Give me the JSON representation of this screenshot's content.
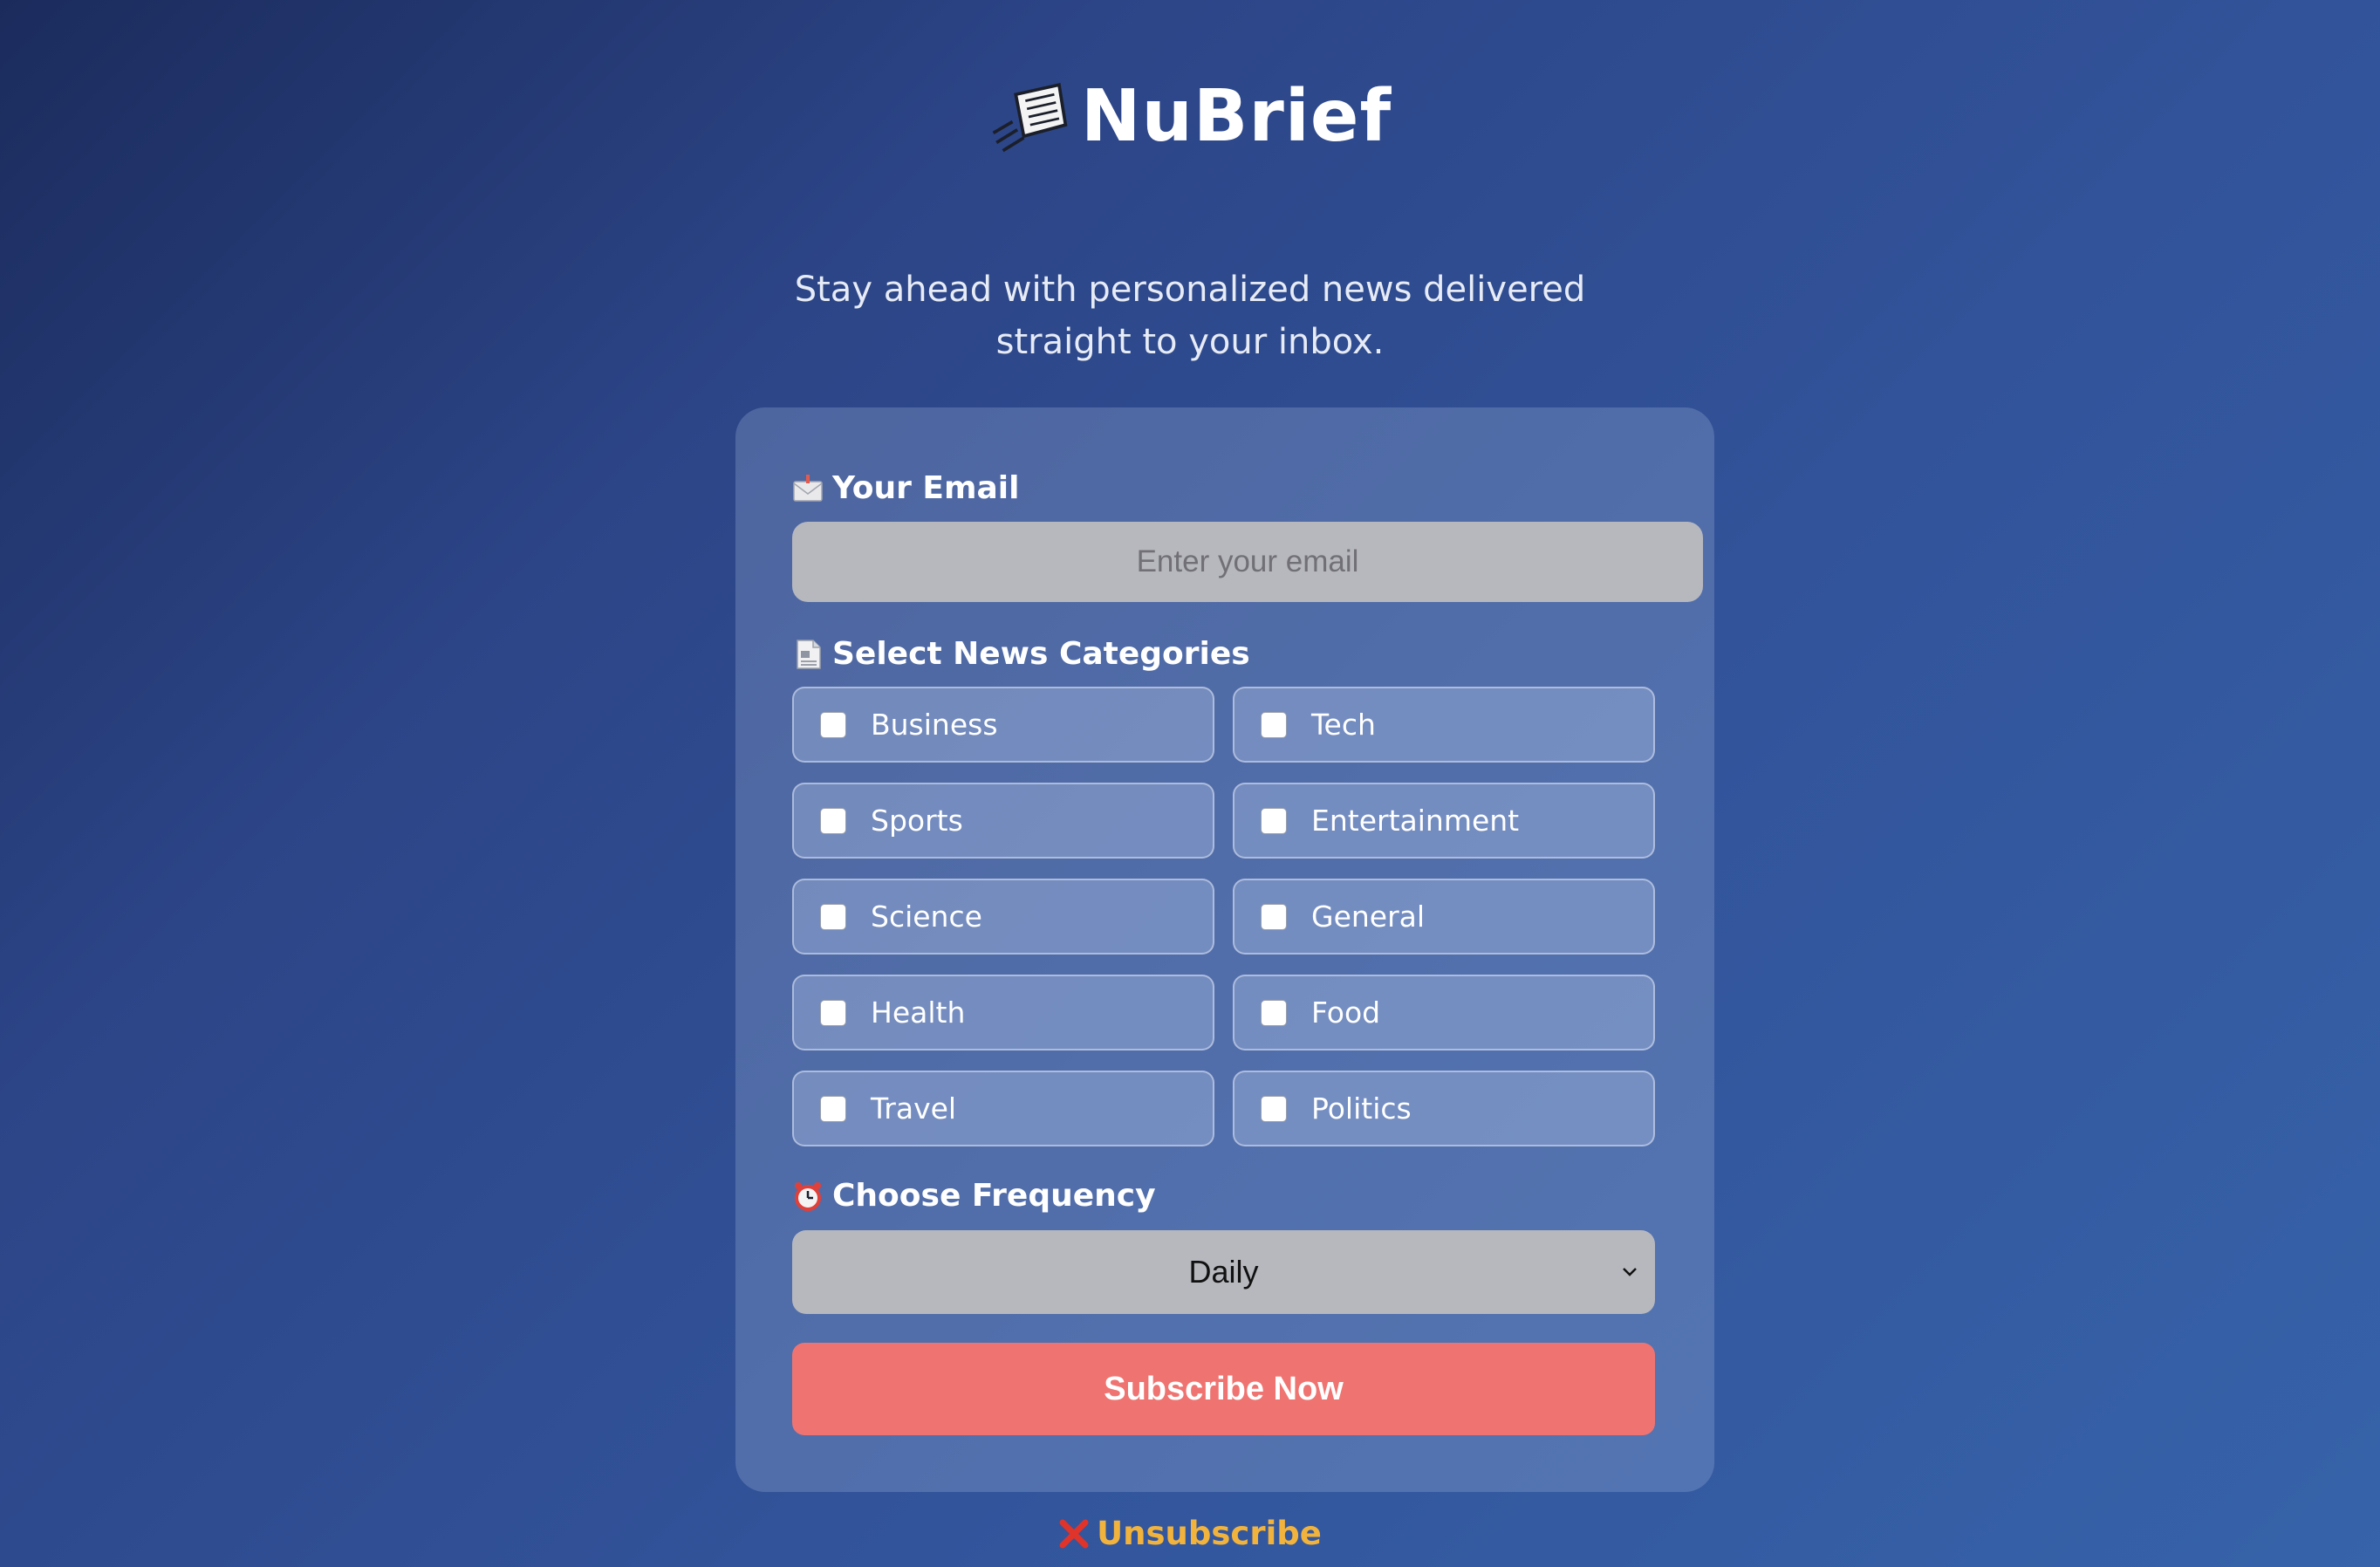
{
  "brand": {
    "name": "NuBrief",
    "icon": "flying-newspaper-icon"
  },
  "tagline": {
    "line1": "Stay ahead with personalized news delivered",
    "line2": "straight to your inbox."
  },
  "form": {
    "email": {
      "label": "Your Email",
      "icon": "envelope-icon",
      "placeholder": "Enter your email",
      "value": ""
    },
    "categories": {
      "label": "Select News Categories",
      "icon": "document-icon",
      "items": [
        {
          "label": "Business",
          "checked": false
        },
        {
          "label": "Tech",
          "checked": false
        },
        {
          "label": "Sports",
          "checked": false
        },
        {
          "label": "Entertainment",
          "checked": false
        },
        {
          "label": "Science",
          "checked": false
        },
        {
          "label": "General",
          "checked": false
        },
        {
          "label": "Health",
          "checked": false
        },
        {
          "label": "Food",
          "checked": false
        },
        {
          "label": "Travel",
          "checked": false
        },
        {
          "label": "Politics",
          "checked": false
        }
      ]
    },
    "frequency": {
      "label": "Choose Frequency",
      "icon": "alarm-clock-icon",
      "selected": "Daily"
    },
    "submit_label": "Subscribe Now"
  },
  "unsubscribe": {
    "label": "Unsubscribe",
    "icon": "red-x-icon"
  },
  "colors": {
    "submit_button": "#ef7471",
    "unsubscribe_text": "#f2b33d",
    "input_bg": "#b7b8be"
  }
}
